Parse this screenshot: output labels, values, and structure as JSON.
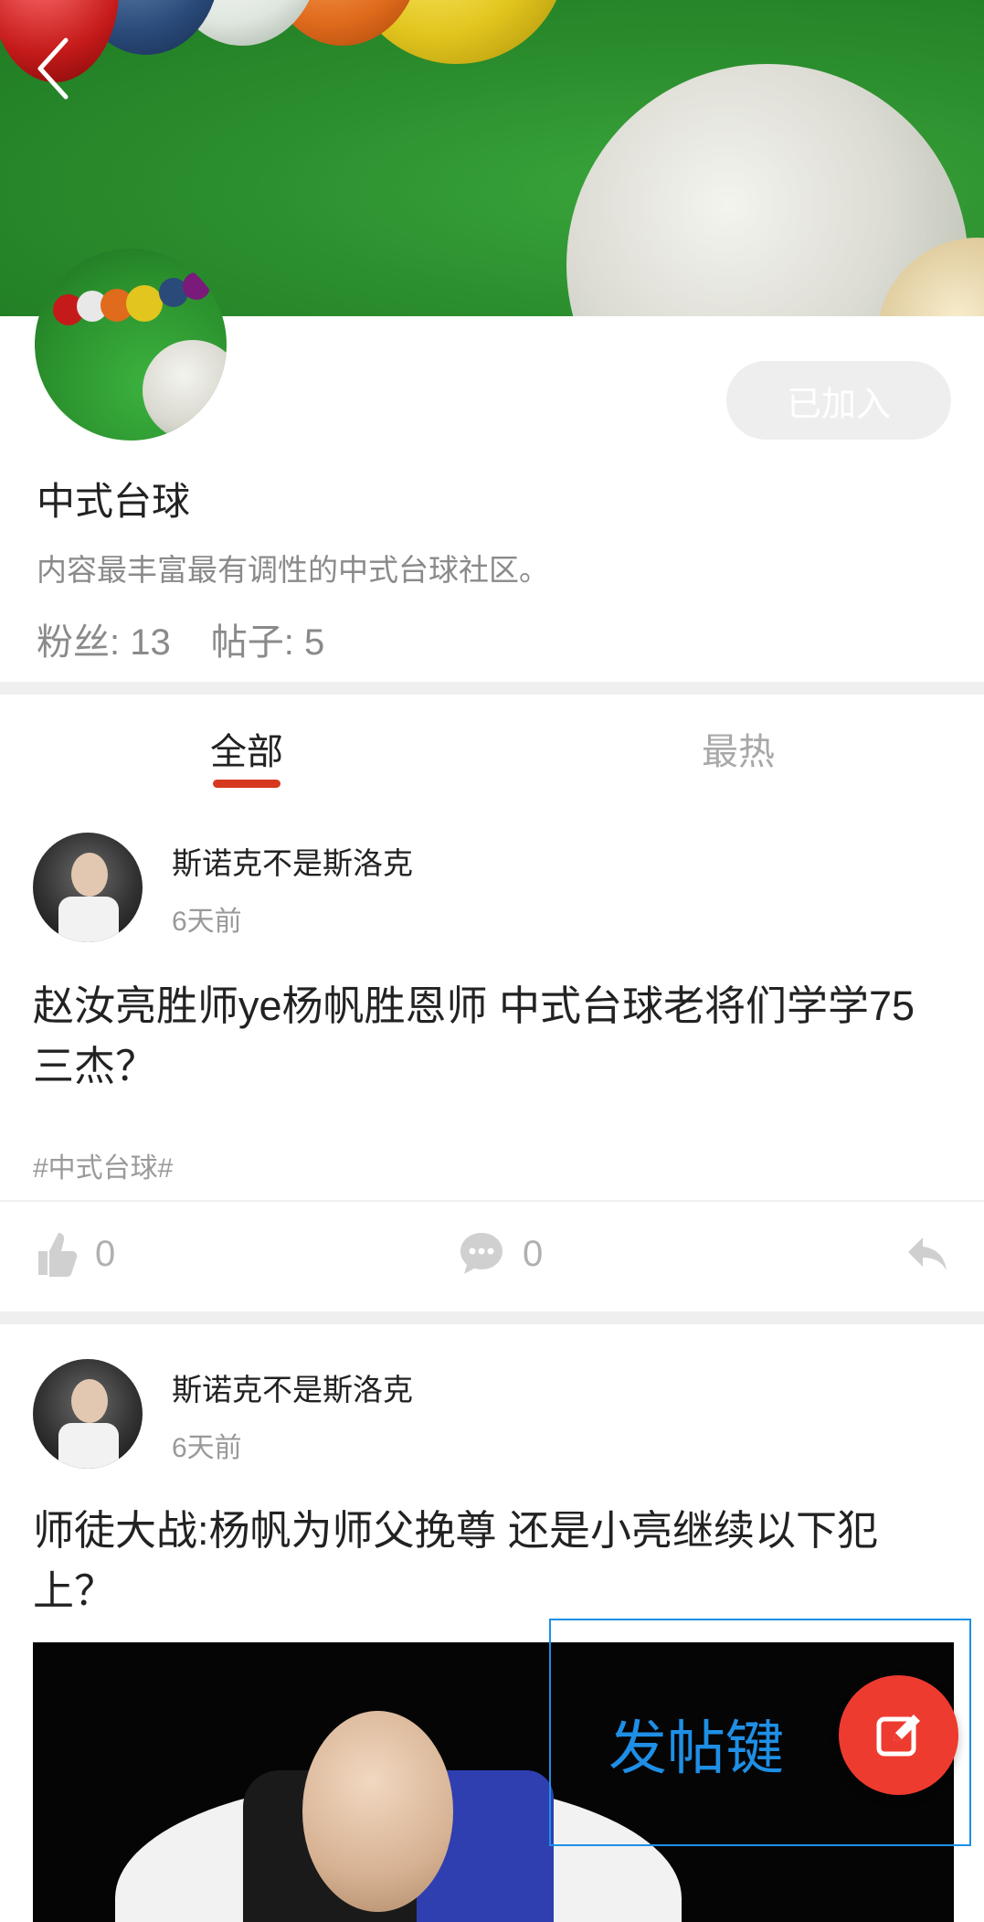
{
  "community": {
    "name": "中式台球",
    "description": "内容最丰富最有调性的中式台球社区。",
    "fans": "粉丝: 13",
    "posts_count": "帖子: 5",
    "join_status": "已加入"
  },
  "tabs": {
    "all": "全部",
    "hot": "最热"
  },
  "posts": [
    {
      "author": "斯诺克不是斯洛克",
      "time": "6天前",
      "title": "赵汝亮胜师ye杨帆胜恩师 中式台球老将们学学75三杰？",
      "tag": "#中式台球#",
      "likes": "0",
      "comments": "0"
    },
    {
      "author": "斯诺克不是斯洛克",
      "time": "6天前",
      "title": "师徒大战:杨帆为师父挽尊 还是小亮继续以下犯上？"
    }
  ],
  "fab": {
    "label": "发帖键"
  },
  "colors": {
    "accent": "#d6391f",
    "fab": "#ee3b2f",
    "annotation": "#1e8fe6",
    "banner_green": "#2c8f2e"
  }
}
